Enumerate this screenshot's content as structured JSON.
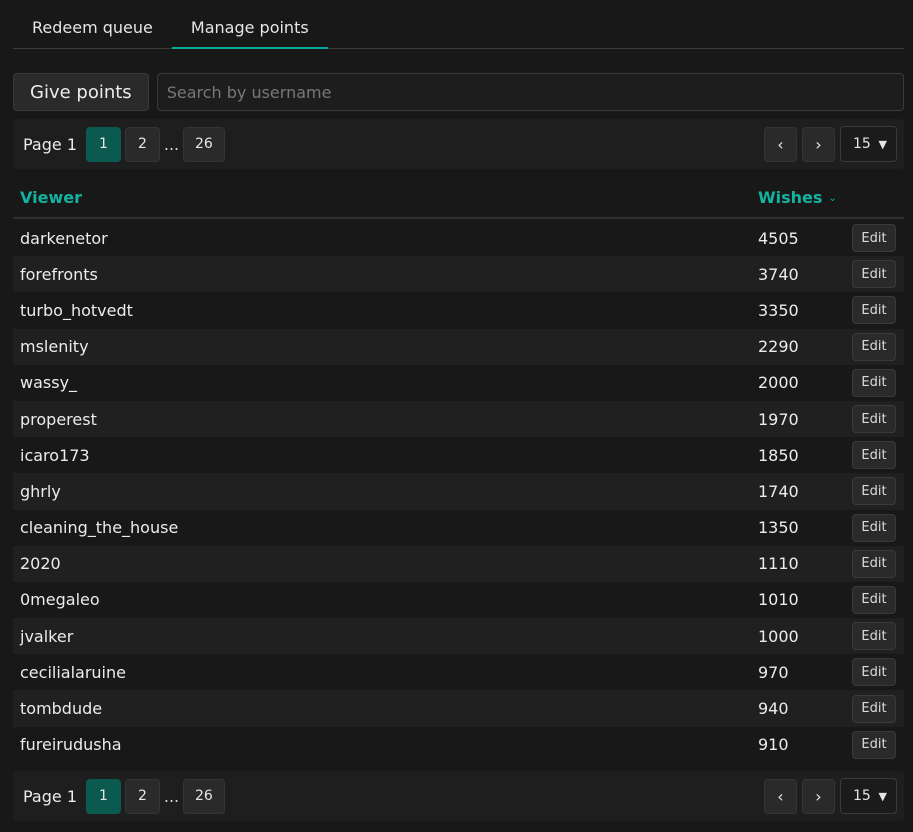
{
  "tabs": [
    {
      "label": "Redeem queue",
      "active": false
    },
    {
      "label": "Manage points",
      "active": true
    }
  ],
  "toolbar": {
    "give_label": "Give points",
    "search_placeholder": "Search by username"
  },
  "pagination": {
    "label": "Page 1",
    "pages": [
      "1",
      "2",
      "26"
    ],
    "ellipsis": "...",
    "current": "1",
    "prev_label": "‹",
    "next_label": "›",
    "per_page": "15"
  },
  "table": {
    "columns": {
      "viewer": "Viewer",
      "wishes": "Wishes"
    },
    "edit_label": "Edit",
    "rows": [
      {
        "viewer": "darkenetor",
        "wishes": "4505"
      },
      {
        "viewer": "forefronts",
        "wishes": "3740"
      },
      {
        "viewer": "turbo_hotvedt",
        "wishes": "3350"
      },
      {
        "viewer": "mslenity",
        "wishes": "2290"
      },
      {
        "viewer": "wassy_",
        "wishes": "2000"
      },
      {
        "viewer": "properest",
        "wishes": "1970"
      },
      {
        "viewer": "icaro173",
        "wishes": "1850"
      },
      {
        "viewer": "ghrly",
        "wishes": "1740"
      },
      {
        "viewer": "cleaning_the_house",
        "wishes": "1350"
      },
      {
        "viewer": "2020",
        "wishes": "1110"
      },
      {
        "viewer": "0megaleo",
        "wishes": "1010"
      },
      {
        "viewer": "jvalker",
        "wishes": "1000"
      },
      {
        "viewer": "cecilialaruine",
        "wishes": "970"
      },
      {
        "viewer": "tombdude",
        "wishes": "940"
      },
      {
        "viewer": "fureirudusha",
        "wishes": "910"
      }
    ]
  },
  "colors": {
    "accent": "#13b3a0",
    "active_page": "#0b5a4f",
    "background": "#181818"
  },
  "icons": {
    "sort": "chevron-down-icon",
    "prev": "chevron-left-icon",
    "next": "chevron-right-icon",
    "select": "caret-down-icon"
  }
}
